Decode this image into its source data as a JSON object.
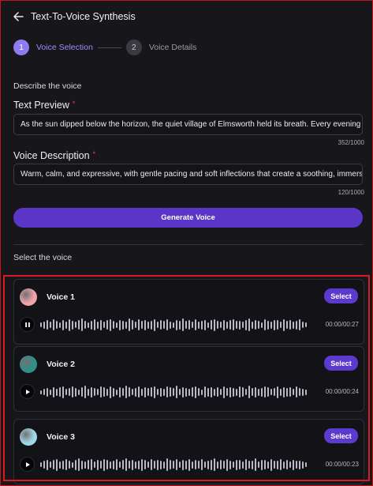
{
  "header": {
    "title": "Text-To-Voice Synthesis"
  },
  "steps": [
    {
      "number": "1",
      "label": "Voice Selection"
    },
    {
      "number": "2",
      "label": "Voice Details"
    }
  ],
  "describe_label": "Describe the voice",
  "text_preview": {
    "label": "Text Preview",
    "required_mark": "*",
    "value": "As the sun dipped below the horizon, the quiet village of Elmsworth held its breath. Every evening",
    "counter": "352/1000"
  },
  "voice_description": {
    "label": "Voice Description",
    "required_mark": "*",
    "value": "Warm, calm, and expressive, with gentle pacing and soft inflections that create a soothing, immersive",
    "counter": "120/1000"
  },
  "generate_button": "Generate Voice",
  "select_label": "Select the voice",
  "voices": [
    {
      "name": "Voice 1",
      "select_label": "Select",
      "time": "00:00/00:27",
      "playing": true,
      "avatar_color": "#f0a3a8"
    },
    {
      "name": "Voice 2",
      "select_label": "Select",
      "time": "00:00/00:24",
      "playing": false,
      "avatar_color": "#2f8f89"
    },
    {
      "name": "Voice 3",
      "select_label": "Select",
      "time": "00:00/00:23",
      "playing": false,
      "avatar_color": "#9fd8e6"
    }
  ],
  "colors": {
    "accent": "#5a35c8",
    "step_active": "#8d7cf0",
    "required": "#d9424a"
  }
}
